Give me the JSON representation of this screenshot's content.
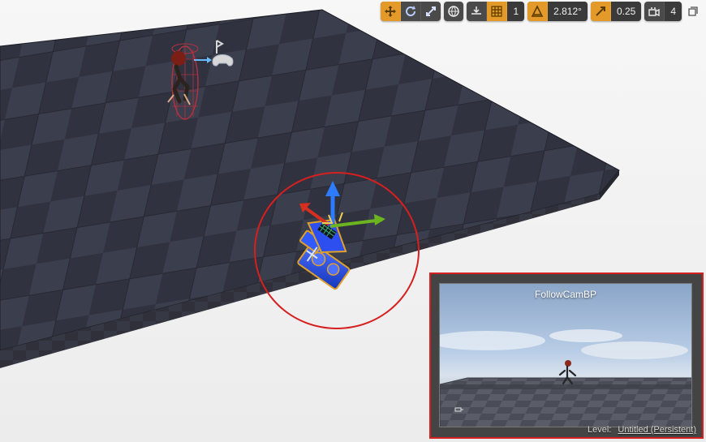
{
  "toolbar": {
    "grid_snap_value": "1",
    "rotation_snap_value": "2.812°",
    "scale_snap_value": "0.25",
    "camera_speed_value": "4"
  },
  "preview": {
    "title": "FollowCamBP",
    "level_label": "Level:",
    "level_value": "Untitled (Persistent)"
  },
  "colors": {
    "accent": "#e49a28",
    "highlight_ring": "#d61f1f",
    "floor_dark": "#2e303d",
    "floor_light": "#3a3d4b"
  },
  "icons": {
    "translate": "translate-icon",
    "rotate": "rotate-icon",
    "scale": "scale-icon",
    "world": "globe-icon",
    "surface_snap": "surface-snap-icon",
    "grid": "grid-icon",
    "angle": "angle-icon",
    "scale_snap": "scale-arrow-icon",
    "camera": "camera-speed-icon",
    "maximize": "maximize-icon"
  }
}
